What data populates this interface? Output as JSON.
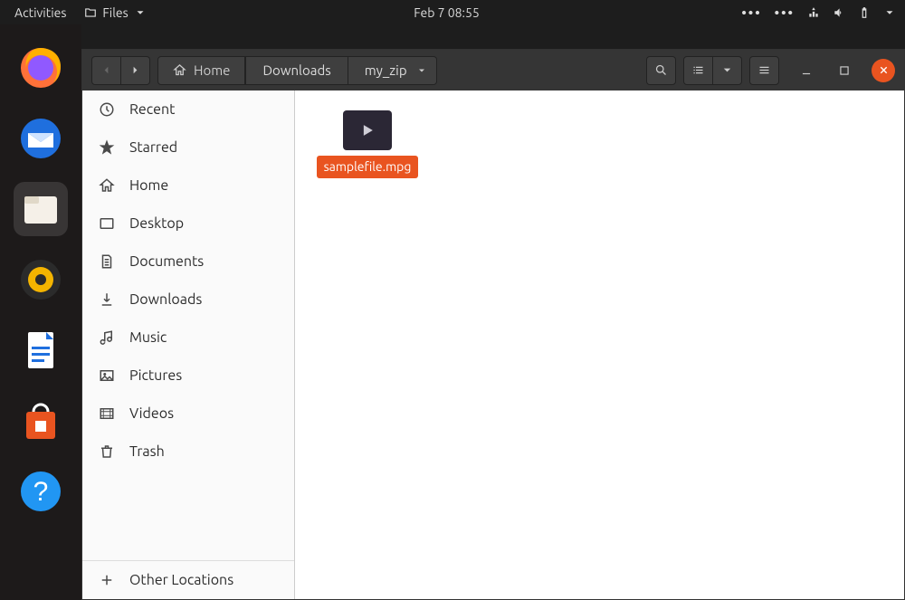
{
  "topbar": {
    "activities": "Activities",
    "app_menu": "Files",
    "clock": "Feb 7  08:55"
  },
  "toolbar": {
    "breadcrumbs": [
      "Home",
      "Downloads",
      "my_zip"
    ]
  },
  "sidebar": {
    "items": [
      {
        "label": "Recent"
      },
      {
        "label": "Starred"
      },
      {
        "label": "Home"
      },
      {
        "label": "Desktop"
      },
      {
        "label": "Documents"
      },
      {
        "label": "Downloads"
      },
      {
        "label": "Music"
      },
      {
        "label": "Pictures"
      },
      {
        "label": "Videos"
      },
      {
        "label": "Trash"
      }
    ],
    "other": "Other Locations"
  },
  "files": [
    {
      "name": "samplefile.mpg"
    }
  ]
}
